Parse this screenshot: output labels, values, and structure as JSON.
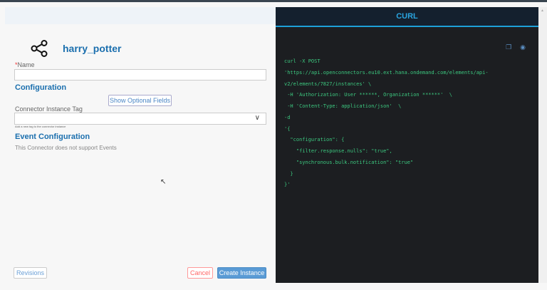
{
  "connector": {
    "name": "harry_potter",
    "icon": "share-icon"
  },
  "form": {
    "name_required": "*",
    "name_label": "Name",
    "name_value": "",
    "configuration_heading": "Configuration",
    "show_optional_label": "Show Optional Fields",
    "tag_label": "Connector Instance Tag",
    "tag_value": "",
    "tag_hint": "Add a new tag to the connector instance",
    "event_heading": "Event Configuration",
    "event_note": "This Connector does not support Events"
  },
  "footer": {
    "revisions": "Revisions",
    "cancel": "Cancel",
    "create": "Create Instance"
  },
  "curl": {
    "title": "CURL",
    "lines": [
      "curl -X POST",
      "'https://api.openconnectors.eu10.ext.hana.ondemand.com/elements/api-",
      "v2/elements/7827/instances' \\",
      " -H 'Authorization: User ******, Organization ******'  \\",
      " -H 'Content-Type: application/json'  \\",
      "-d",
      "'{",
      "  \"configuration\": {",
      "    \"filter.response.nulls\": \"true\",",
      "    \"synchronous.bulk.notification\": \"true\"",
      "  }",
      "}'"
    ]
  }
}
